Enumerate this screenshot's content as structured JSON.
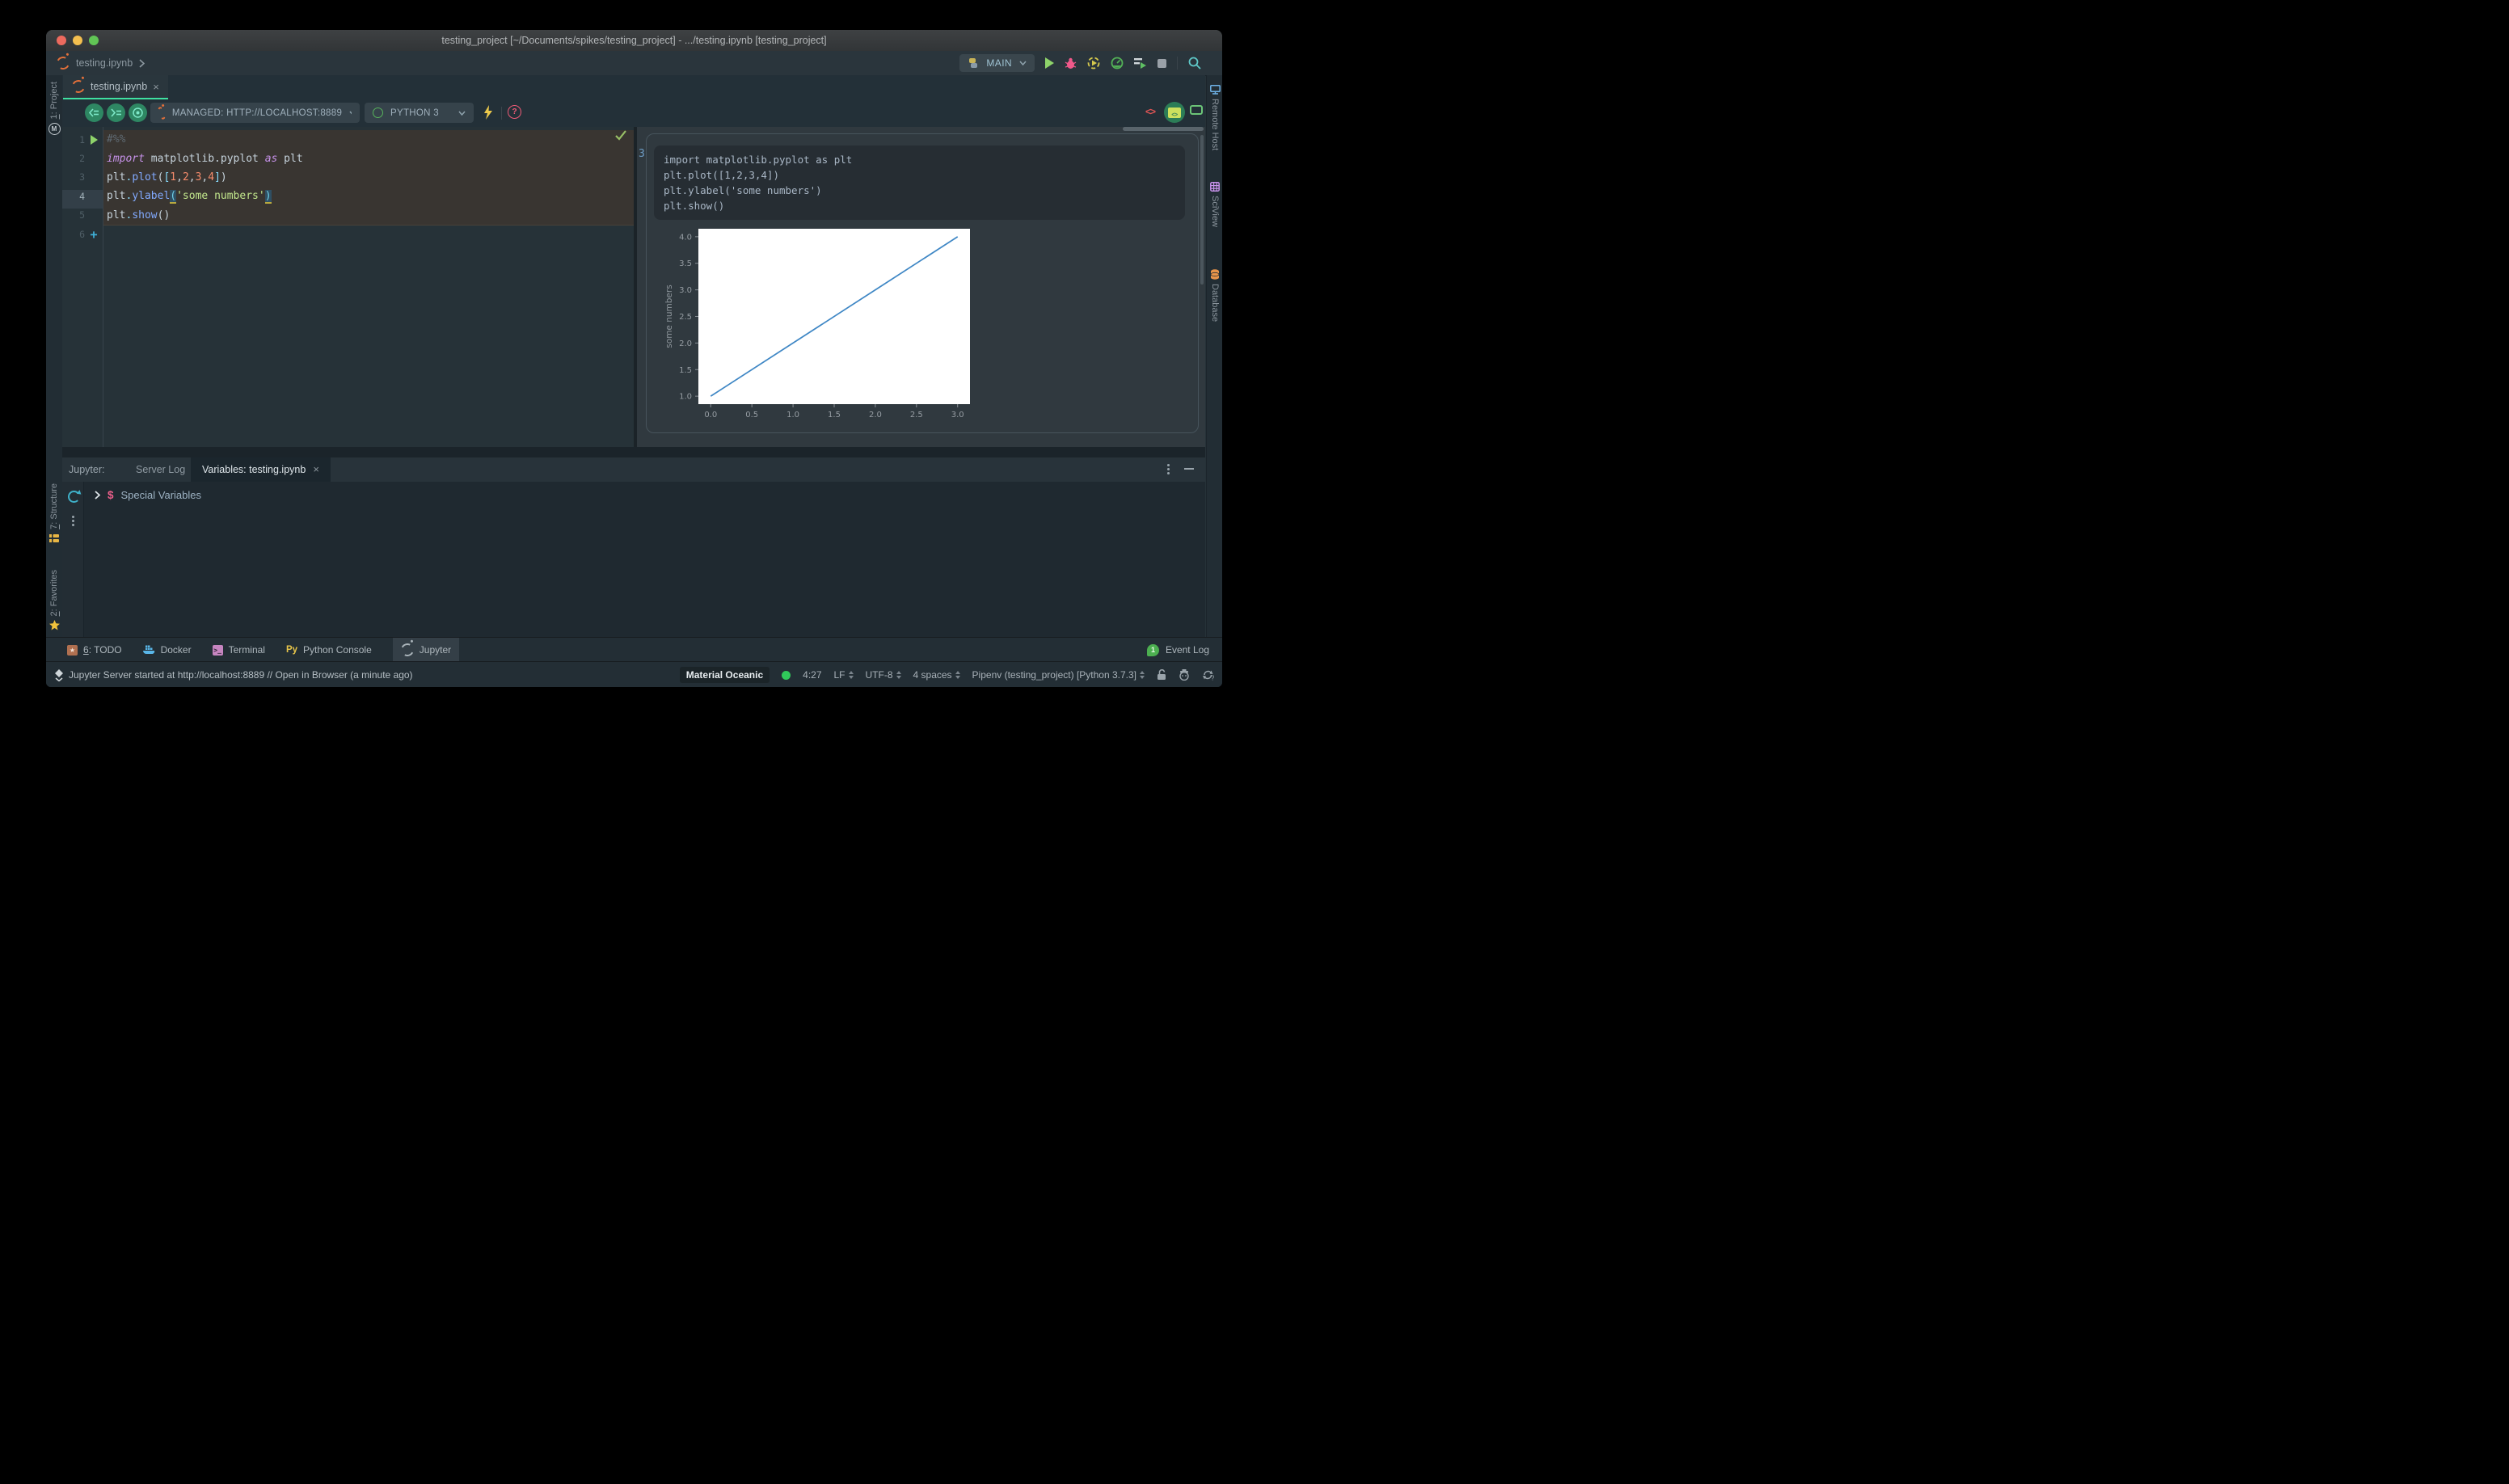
{
  "window": {
    "title": "testing_project [~/Documents/spikes/testing_project] - .../testing.ipynb [testing_project]"
  },
  "icons": {
    "close_glyph": "×",
    "help_glyph": "?",
    "python_console_glyph": "Py",
    "terminal_glyph": ">_",
    "todo_glyph": "★",
    "breadcrumb_chevron": "›"
  },
  "breadcrumb": {
    "file": "testing.ipynb"
  },
  "run_widget": {
    "config": "MAIN"
  },
  "editor_tab": {
    "label": "testing.ipynb"
  },
  "notebook_toolbar": {
    "server": "MANAGED: HTTP://LOCALHOST:8889",
    "kernel": "PYTHON 3"
  },
  "editor": {
    "lines": [
      {
        "num": "1",
        "play": true,
        "tokens": [
          {
            "t": "#%%",
            "c": "comment"
          }
        ]
      },
      {
        "num": "2",
        "tokens": [
          {
            "t": "import",
            "c": "kw"
          },
          {
            "t": " matplotlib.pyplot ",
            "c": "plain"
          },
          {
            "t": "as",
            "c": "kw"
          },
          {
            "t": " plt",
            "c": "plain"
          }
        ]
      },
      {
        "num": "3",
        "tokens": [
          {
            "t": "plt",
            "c": "plain"
          },
          {
            "t": ".",
            "c": "op"
          },
          {
            "t": "plot",
            "c": "fn"
          },
          {
            "t": "(",
            "c": "plain"
          },
          {
            "t": "[",
            "c": "br"
          },
          {
            "t": "1",
            "c": "num"
          },
          {
            "t": ",",
            "c": "plain"
          },
          {
            "t": "2",
            "c": "num"
          },
          {
            "t": ",",
            "c": "plain"
          },
          {
            "t": "3",
            "c": "num"
          },
          {
            "t": ",",
            "c": "plain"
          },
          {
            "t": "4",
            "c": "num"
          },
          {
            "t": "]",
            "c": "br"
          },
          {
            "t": ")",
            "c": "plain"
          }
        ]
      },
      {
        "num": "4",
        "current": true,
        "tokens": [
          {
            "t": "plt",
            "c": "plain"
          },
          {
            "t": ".",
            "c": "op"
          },
          {
            "t": "ylabel",
            "c": "fn"
          },
          {
            "t": "(",
            "c": "paren-hl"
          },
          {
            "t": "'some numbers'",
            "c": "str"
          },
          {
            "t": ")",
            "c": "paren-hl"
          }
        ]
      },
      {
        "num": "5",
        "tokens": [
          {
            "t": "plt",
            "c": "plain"
          },
          {
            "t": ".",
            "c": "op"
          },
          {
            "t": "show",
            "c": "fn"
          },
          {
            "t": "(",
            "c": "plain"
          },
          {
            "t": ")",
            "c": "plain"
          }
        ]
      },
      {
        "num": "6",
        "add": true,
        "tokens": []
      }
    ]
  },
  "output_panel": {
    "cell_number": "3",
    "code_lines": [
      "import matplotlib.pyplot as plt",
      "plt.plot([1,2,3,4])",
      "plt.ylabel('some numbers')",
      "plt.show()"
    ]
  },
  "chart_data": {
    "type": "line",
    "x": [
      0,
      1,
      2,
      3
    ],
    "y": [
      1,
      2,
      3,
      4
    ],
    "title": "",
    "xlabel": "",
    "ylabel": "some numbers",
    "xticks": [
      0.0,
      0.5,
      1.0,
      1.5,
      2.0,
      2.5,
      3.0
    ],
    "yticks": [
      1.0,
      1.5,
      2.0,
      2.5,
      3.0,
      3.5,
      4.0
    ],
    "xlim": [
      -0.15,
      3.15
    ],
    "ylim": [
      0.85,
      4.15
    ],
    "line_color": "#3f87c5",
    "axes_background": "#ffffff",
    "grid": false,
    "legend": false
  },
  "bottom_panel": {
    "title": "Jupyter:",
    "tab_server_log": "Server Log",
    "tab_variables": "Variables: testing.ipynb",
    "special_variables_label": "Special Variables"
  },
  "toolwindow_bar": {
    "todo_mnemonic": "6",
    "todo_rest": ": TODO",
    "docker": "Docker",
    "terminal": "Terminal",
    "python_console": "Python Console",
    "jupyter": "Jupyter",
    "event_count": "1",
    "event_log": "Event Log"
  },
  "status_bar": {
    "message": "Jupyter Server started at http://localhost:8889 // Open in Browser (a minute ago)",
    "theme": "Material Oceanic",
    "caret": "4:27",
    "line_sep": "LF",
    "encoding": "UTF-8",
    "indent": "4 spaces",
    "interpreter": "Pipenv (testing_project) [Python 3.7.3]"
  },
  "left_stripe": {
    "project_m": "1",
    "project_rest": ": Project",
    "structure_m": "7",
    "structure_rest": ": Structure",
    "favorites_m": "2",
    "favorites_rest": ": Favorites"
  },
  "right_stripe": {
    "remote_host": "Remote Host",
    "sciview": "SciView",
    "database": "Database"
  }
}
